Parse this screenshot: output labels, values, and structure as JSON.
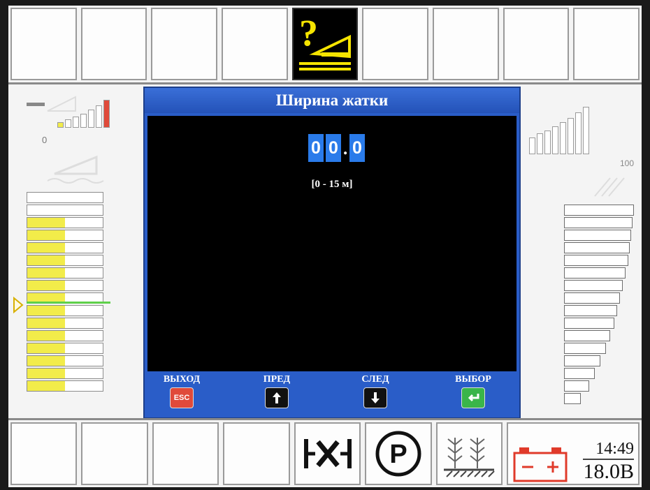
{
  "dialog": {
    "title": "Ширина жатки",
    "value_digits": [
      "0",
      "0",
      "0"
    ],
    "decimal_separator": ".",
    "range": "[0 - 15 м]"
  },
  "footer": {
    "exit_label": "ВЫХОД",
    "exit_key": "ESC",
    "prev_label": "ПРЕД",
    "next_label": "СЛЕД",
    "select_label": "ВЫБОР"
  },
  "left_panel": {
    "zero_label": "0",
    "level_fill_fraction": 0.5
  },
  "right_panel": {
    "max_label": "100"
  },
  "status": {
    "time": "14:49",
    "voltage": "18.0В"
  },
  "bottom_icons": [
    "empty",
    "empty",
    "empty",
    "empty",
    "axle-lock-icon",
    "parking-icon",
    "crop-icon",
    "battery-icon"
  ],
  "colors": {
    "dialog_blue": "#2a5dc8",
    "digit_blue": "#2a7bea",
    "warning_yellow": "#f5e400",
    "esc_red": "#e04a3a",
    "enter_green": "#3ab54a",
    "battery_red": "#e03a2a",
    "level_yellow": "#f2ec4a",
    "level_line_green": "#5fd04a"
  }
}
